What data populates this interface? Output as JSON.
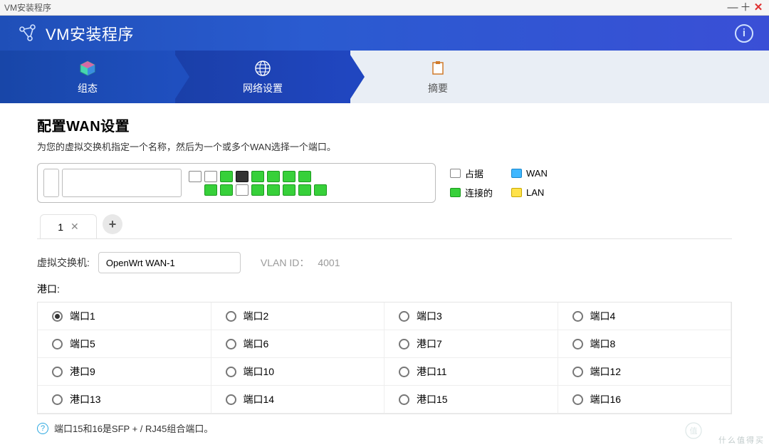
{
  "window": {
    "title": "VM安装程序"
  },
  "hero": {
    "title": "VM安装程序"
  },
  "steps": [
    {
      "label": "组态"
    },
    {
      "label": "网络设置"
    },
    {
      "label": "摘要"
    }
  ],
  "section": {
    "heading": "配置WAN设置",
    "description": "为您的虚拟交换机指定一个名称，然后为一个或多个WAN选择一个端口。"
  },
  "legend": {
    "occupied": "占据",
    "wan": "WAN",
    "connected": "连接的",
    "lan": "LAN"
  },
  "tabs": {
    "items": [
      {
        "label": "1"
      }
    ]
  },
  "form": {
    "vswitch_label": "虚拟交换机:",
    "vswitch_value": "OpenWrt WAN-1",
    "vlan_label": "VLAN ID：",
    "vlan_value": "4001",
    "ports_label": "港口:"
  },
  "ports": [
    {
      "label": "端口1",
      "selected": true
    },
    {
      "label": "端口2",
      "selected": false
    },
    {
      "label": "端口3",
      "selected": false
    },
    {
      "label": "端口4",
      "selected": false
    },
    {
      "label": "端口5",
      "selected": false
    },
    {
      "label": "端口6",
      "selected": false
    },
    {
      "label": "港口7",
      "selected": false
    },
    {
      "label": "端口8",
      "selected": false
    },
    {
      "label": "港口9",
      "selected": false
    },
    {
      "label": "端口10",
      "selected": false
    },
    {
      "label": "港口11",
      "selected": false
    },
    {
      "label": "端口12",
      "selected": false
    },
    {
      "label": "港口13",
      "selected": false
    },
    {
      "label": "端口14",
      "selected": false
    },
    {
      "label": "港口15",
      "selected": false
    },
    {
      "label": "端口16",
      "selected": false
    }
  ],
  "hint": "端口15和16是SFP + / RJ45组合端口。",
  "watermark": "什么值得买"
}
